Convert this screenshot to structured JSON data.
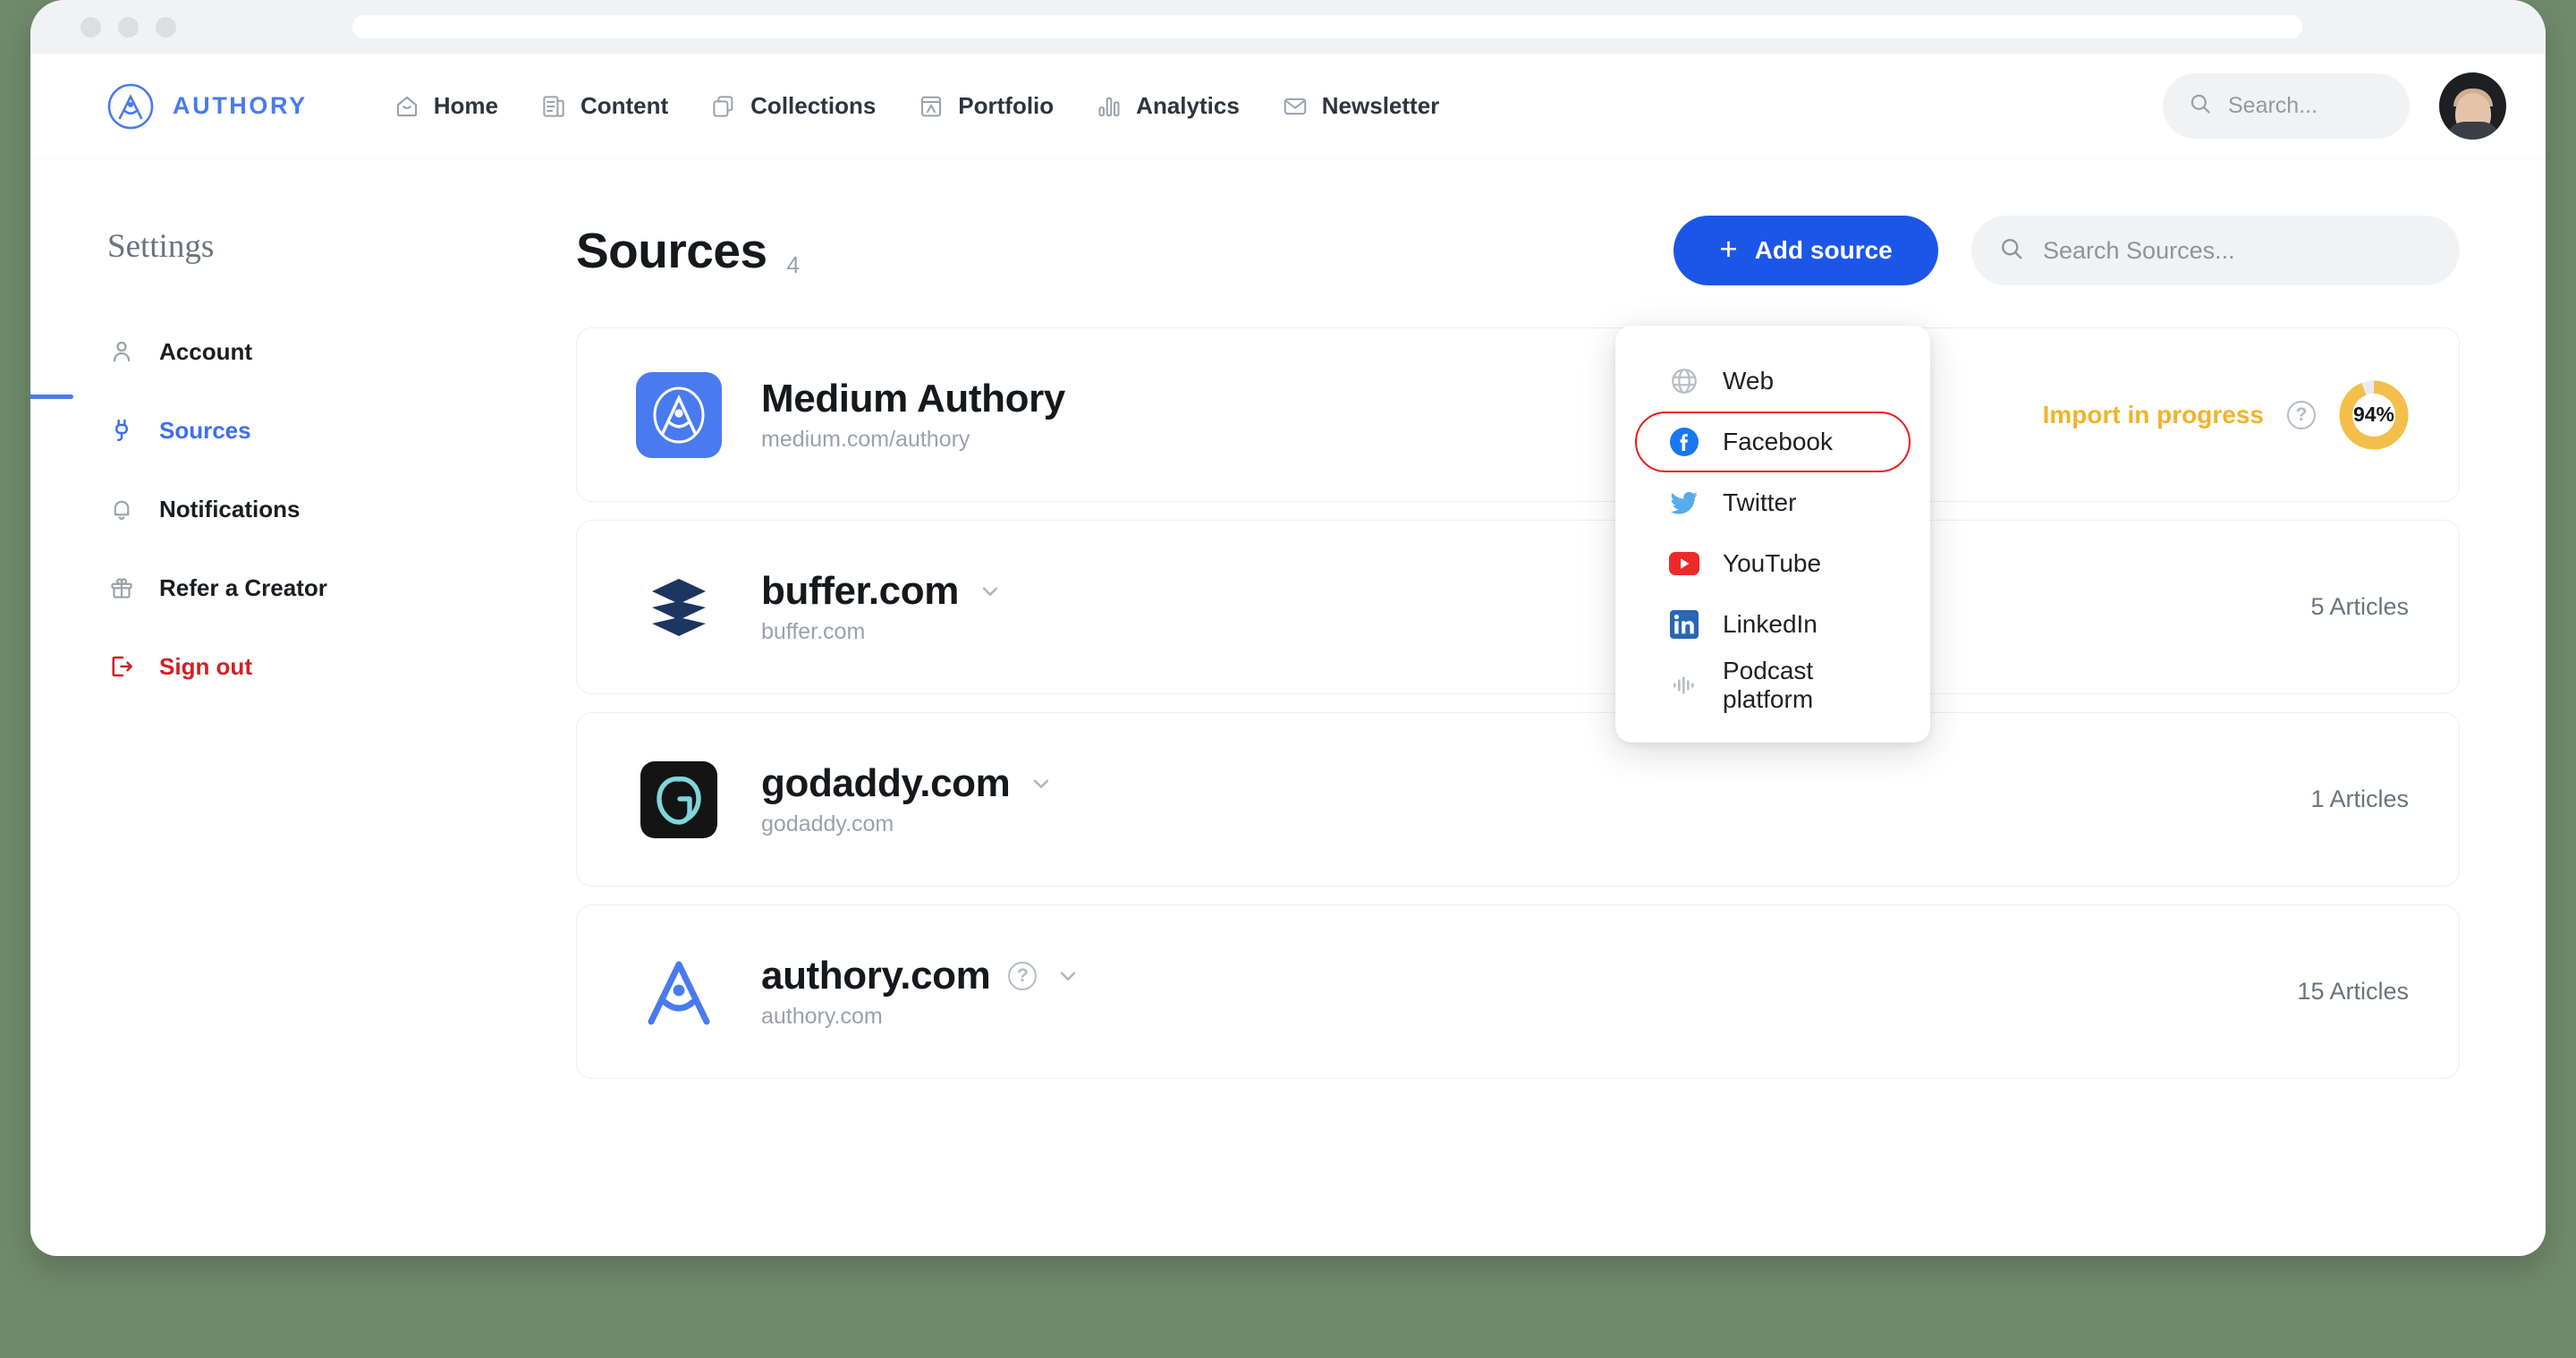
{
  "browser": {
    "traffic_lights": [
      "close-dot",
      "minimize-dot",
      "maximize-dot"
    ],
    "url_value": ""
  },
  "brand": {
    "name": "AUTHORY",
    "logo_icon": "authory-compass-logo-icon"
  },
  "topnav": {
    "items": [
      {
        "label": "Home",
        "icon": "home-icon"
      },
      {
        "label": "Content",
        "icon": "document-list-icon"
      },
      {
        "label": "Collections",
        "icon": "copy-stack-icon"
      },
      {
        "label": "Portfolio",
        "icon": "portfolio-window-icon"
      },
      {
        "label": "Analytics",
        "icon": "bar-chart-icon"
      },
      {
        "label": "Newsletter",
        "icon": "envelope-icon"
      }
    ],
    "search": {
      "placeholder": "Search...",
      "value": "",
      "icon": "search-icon"
    },
    "avatar_alt": "user-avatar"
  },
  "sidebar": {
    "title": "Settings",
    "items": [
      {
        "label": "Account",
        "icon": "person-icon",
        "state": "default"
      },
      {
        "label": "Sources",
        "icon": "plug-icon",
        "state": "active"
      },
      {
        "label": "Notifications",
        "icon": "bell-icon",
        "state": "default"
      },
      {
        "label": "Refer a Creator",
        "icon": "gift-icon",
        "state": "default"
      },
      {
        "label": "Sign out",
        "icon": "logout-icon",
        "state": "danger"
      }
    ]
  },
  "main": {
    "title": "Sources",
    "count": "4",
    "add_button": {
      "label": "Add source",
      "icon": "plus-icon"
    },
    "search": {
      "placeholder": "Search Sources...",
      "value": "",
      "icon": "search-icon"
    },
    "cards": [
      {
        "title": "Medium Authory",
        "subtitle": "medium.com/authory",
        "logo_icon": "medium-authory-logo-icon",
        "status_label": "Import in progress",
        "help_icon": "help-circle-icon",
        "progress_percent": "94%",
        "progress_value": 94,
        "has_chevron": false,
        "has_title_help": false,
        "articles": ""
      },
      {
        "title": "buffer.com",
        "subtitle": "buffer.com",
        "logo_icon": "buffer-logo-icon",
        "status_label": "",
        "progress_percent": "",
        "has_chevron": true,
        "has_title_help": false,
        "articles": "5 Articles"
      },
      {
        "title": "godaddy.com",
        "subtitle": "godaddy.com",
        "logo_icon": "godaddy-logo-icon",
        "status_label": "",
        "progress_percent": "",
        "has_chevron": true,
        "has_title_help": false,
        "articles": "1 Articles"
      },
      {
        "title": "authory.com",
        "subtitle": "authory.com",
        "logo_icon": "authory-logo-icon",
        "status_label": "",
        "progress_percent": "",
        "has_chevron": true,
        "has_title_help": true,
        "help_icon": "help-circle-icon",
        "articles": "15 Articles"
      }
    ]
  },
  "add_source_menu": {
    "items": [
      {
        "label": "Web",
        "icon": "globe-icon",
        "highlighted": false
      },
      {
        "label": "Facebook",
        "icon": "facebook-icon",
        "highlighted": true
      },
      {
        "label": "Twitter",
        "icon": "twitter-icon",
        "highlighted": false
      },
      {
        "label": "YouTube",
        "icon": "youtube-icon",
        "highlighted": false
      },
      {
        "label": "LinkedIn",
        "icon": "linkedin-icon",
        "highlighted": false
      },
      {
        "label": "Podcast platform",
        "icon": "podcast-waveform-icon",
        "highlighted": false
      }
    ]
  },
  "colors": {
    "brand_blue": "#4a7af0",
    "accent_blue": "#1c56e8",
    "active_blue": "#3d6ff0",
    "danger_red": "#cf2026",
    "highlight_red": "#f01818",
    "warning_amber": "#f0b429",
    "page_bg": "#6f8a6a"
  }
}
